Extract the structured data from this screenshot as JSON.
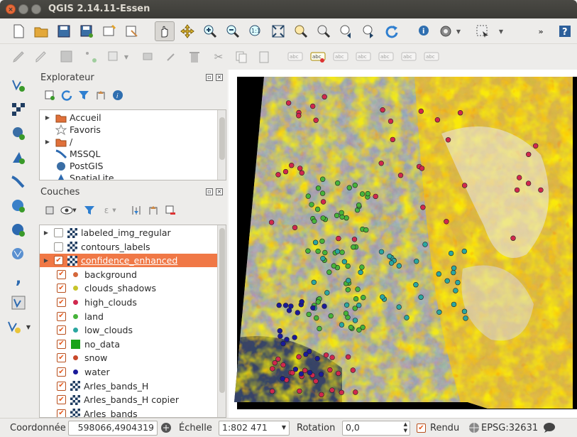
{
  "window": {
    "title": "QGIS 2.14.11-Essen"
  },
  "colors": {
    "accent": "#f07846",
    "heat_yellow": "#ffe600",
    "heat_orange": "#ffaa00",
    "heat_red": "#ff3300"
  },
  "explorer": {
    "title": "Explorateur",
    "items": [
      {
        "label": "Accueil",
        "icon": "folder-icon",
        "expand": true
      },
      {
        "label": "Favoris",
        "icon": "star-icon",
        "expand": false
      },
      {
        "label": "/",
        "icon": "folder-icon",
        "expand": true
      },
      {
        "label": "MSSQL",
        "icon": "mssql-icon",
        "expand": false
      },
      {
        "label": "PostGIS",
        "icon": "postgis-icon",
        "expand": false
      },
      {
        "label": "SpatiaLite",
        "icon": "spatialite-icon",
        "expand": false
      }
    ]
  },
  "layers": {
    "title": "Couches",
    "items": [
      {
        "label": "labeled_img_regular",
        "kind": "raster",
        "checked": false,
        "indent": 0,
        "expand": true,
        "selected": false
      },
      {
        "label": "contours_labels",
        "kind": "raster",
        "checked": false,
        "indent": 0,
        "expand": false,
        "selected": false
      },
      {
        "label": "confidence_enhanced",
        "kind": "raster",
        "checked": true,
        "indent": 0,
        "expand": true,
        "selected": true
      },
      {
        "label": "background",
        "kind": "dot",
        "color": "#d4673b",
        "checked": true,
        "indent": 1
      },
      {
        "label": "clouds_shadows",
        "kind": "dot",
        "color": "#c7c42a",
        "checked": true,
        "indent": 1
      },
      {
        "label": "high_clouds",
        "kind": "dot",
        "color": "#d0284e",
        "checked": true,
        "indent": 1
      },
      {
        "label": "land",
        "kind": "dot",
        "color": "#46b33a",
        "checked": true,
        "indent": 1
      },
      {
        "label": "low_clouds",
        "kind": "dot",
        "color": "#2aa6a0",
        "checked": true,
        "indent": 1
      },
      {
        "label": "no_data",
        "kind": "square",
        "color": "#19a319",
        "checked": true,
        "indent": 1
      },
      {
        "label": "snow",
        "kind": "dot",
        "color": "#c8482a",
        "checked": true,
        "indent": 1
      },
      {
        "label": "water",
        "kind": "dot",
        "color": "#1a1a9a",
        "checked": true,
        "indent": 1
      },
      {
        "label": "Arles_bands_H",
        "kind": "raster",
        "checked": true,
        "indent": 1
      },
      {
        "label": "Arles_bands_H copier",
        "kind": "raster",
        "checked": true,
        "indent": 1
      },
      {
        "label": "Arles_bands",
        "kind": "raster",
        "checked": true,
        "indent": 1
      }
    ]
  },
  "status": {
    "coord_label": "Coordonnée",
    "coord_value": "598066,4904319",
    "scale_label": "Échelle",
    "scale_value": "1:802 471",
    "rotation_label": "Rotation",
    "rotation_value": "0,0",
    "render_label": "Rendu",
    "crs": "EPSG:32631"
  }
}
